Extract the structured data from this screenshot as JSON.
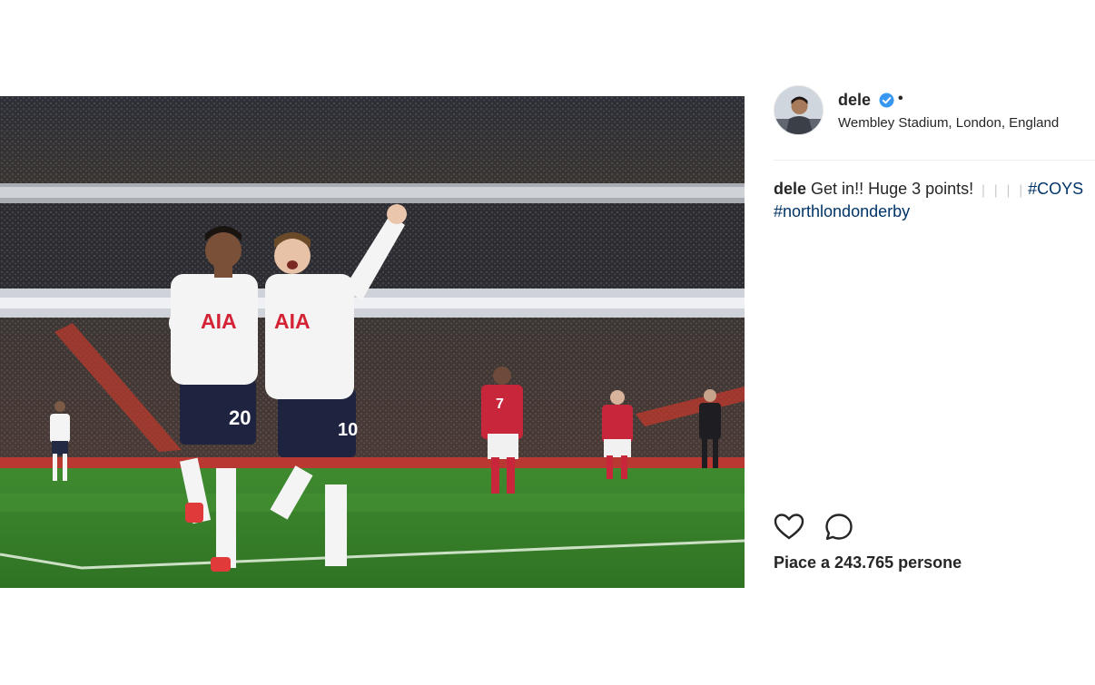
{
  "post": {
    "username": "dele",
    "location": "Wembley Stadium, London, England",
    "separator_dot": "•",
    "caption": {
      "username": "dele",
      "text": "Get in!! Huge 3 points!",
      "emoji": "❘❘❘❘",
      "hashtags": [
        "#COYS",
        "#northlondonderby"
      ]
    },
    "likes_text": "Piace a 243.765 persone"
  },
  "photo": {
    "shirt_sponsor": "AIA",
    "player_numbers": [
      "20",
      "10",
      "7"
    ]
  },
  "icons": {
    "verified": "verified-badge-icon",
    "like": "heart-icon",
    "comment": "comment-bubble-icon"
  },
  "colors": {
    "verified_blue": "#3897f0",
    "hashtag": "#003569",
    "text": "#262626",
    "divider": "#efefef"
  }
}
